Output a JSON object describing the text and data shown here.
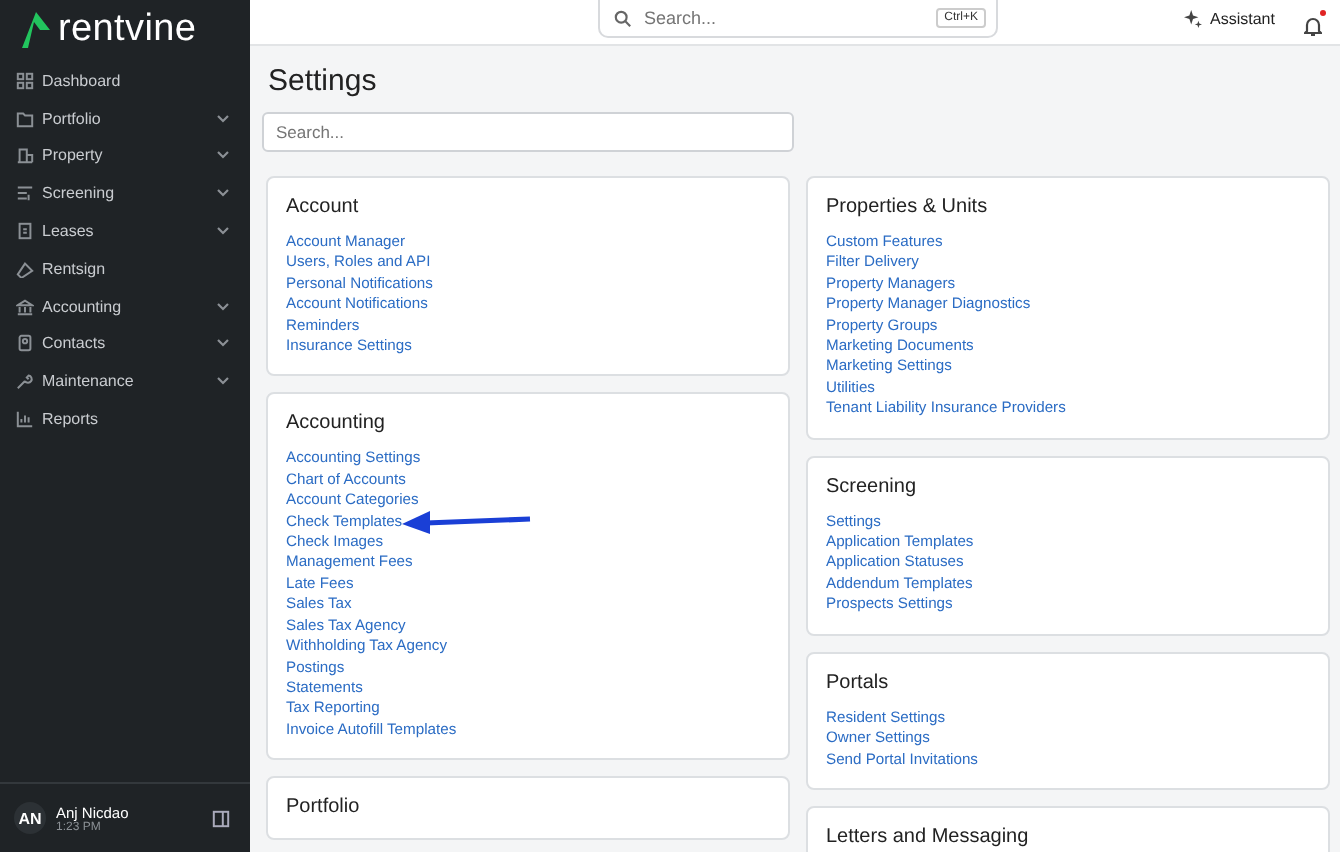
{
  "brand": "rentvine",
  "sidebar": {
    "items": [
      {
        "label": "Dashboard",
        "expandable": false
      },
      {
        "label": "Portfolio",
        "expandable": true
      },
      {
        "label": "Property",
        "expandable": true
      },
      {
        "label": "Screening",
        "expandable": true
      },
      {
        "label": "Leases",
        "expandable": true
      },
      {
        "label": "Rentsign",
        "expandable": false
      },
      {
        "label": "Accounting",
        "expandable": true
      },
      {
        "label": "Contacts",
        "expandable": true
      },
      {
        "label": "Maintenance",
        "expandable": true
      },
      {
        "label": "Reports",
        "expandable": false
      }
    ],
    "user": {
      "initials": "AN",
      "name": "Anj Nicdao",
      "time": "1:23 PM"
    }
  },
  "topbar": {
    "search": {
      "placeholder": "Search...",
      "shortcut": "Ctrl+K"
    },
    "assistant": "Assistant",
    "notification_dot": true
  },
  "page": {
    "title": "Settings",
    "search": {
      "placeholder": "Search..."
    }
  },
  "columns": [
    [
      {
        "title": "Account",
        "links": [
          "Account Manager",
          "Users, Roles and API",
          "Personal Notifications",
          "Account Notifications",
          "Reminders",
          "Insurance Settings"
        ]
      },
      {
        "title": "Accounting",
        "links": [
          "Accounting Settings",
          "Chart of Accounts",
          "Account Categories",
          "Check Templates",
          "Check Images",
          "Management Fees",
          "Late Fees",
          "Sales Tax",
          "Sales Tax Agency",
          "Withholding Tax Agency",
          "Postings",
          "Statements",
          "Tax Reporting",
          "Invoice Autofill Templates"
        ]
      },
      {
        "title": "Portfolio"
      }
    ],
    [
      {
        "title": "Properties & Units",
        "links": [
          "Custom Features",
          "Filter Delivery",
          "Property Managers",
          "Property Manager Diagnostics",
          "Property Groups",
          "Marketing Documents",
          "Marketing Settings",
          "Utilities",
          "Tenant Liability Insurance Providers"
        ]
      },
      {
        "title": "Screening",
        "links": [
          "Settings",
          "Application Templates",
          "Application Statuses",
          "Addendum Templates",
          "Prospects Settings"
        ]
      },
      {
        "title": "Portals",
        "links": [
          "Resident Settings",
          "Owner Settings",
          "Send Portal Invitations"
        ]
      },
      {
        "title": "Letters and Messaging"
      }
    ]
  ]
}
